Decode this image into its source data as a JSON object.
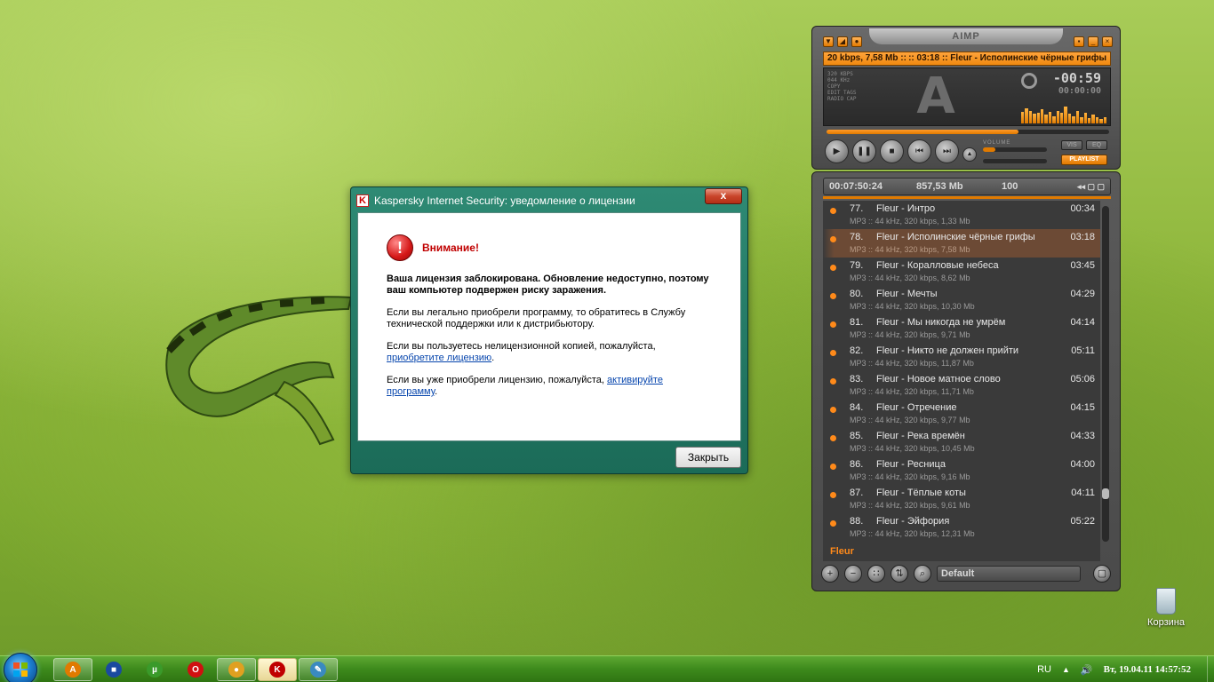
{
  "kaspersky": {
    "title": "Kaspersky Internet Security: уведомление о лицензии",
    "logo_letter": "K",
    "close_glyph": "x",
    "warning_glyph": "!",
    "heading": "Внимание!",
    "p1": "Ваша лицензия заблокирована. Обновление недоступно, поэтому ваш компьютер подвержен риску заражения.",
    "p2": "Если вы легально приобрели программу, то обратитесь в Службу технической поддержки или к дистрибьютору.",
    "p3_text": "Если вы пользуетесь нелицензионной копией, пожалуйста,",
    "p3_link": "приобретите лицензию",
    "p3_end": ".",
    "p4_text": "Если вы уже приобрели лицензию, пожалуйста,",
    "p4_link": "активируйте программу",
    "p4_end": ".",
    "close_button": "Закрыть",
    "accent": "#1b6b58"
  },
  "aimp": {
    "app_name": "AIMP",
    "ticker_left": "20 kbps, 7,58 Mb ::",
    "ticker_right": ":: 03:18 :: Fleur - Исполинские чёрные грифы",
    "info_lines": [
      "320 KBPS",
      "044 KHz",
      "COPY",
      "EDIT TAGS",
      "RADIO CAP"
    ],
    "logo_letter": "A",
    "time_remaining": "-00:59",
    "time_elapsed": "00:00:00",
    "seek_progress": 0.68,
    "volume_label": "VOLUME",
    "volume_level": 0.2,
    "btn_vis": "VIS",
    "btn_eq": "EQ",
    "btn_playlist": "PLAYLIST",
    "controls": [
      "play-icon",
      "pause-icon",
      "stop-icon",
      "prev-icon",
      "next-icon",
      "eject-icon"
    ],
    "accent": "#e07a00",
    "vis_bars": [
      0.55,
      0.7,
      0.6,
      0.45,
      0.5,
      0.65,
      0.4,
      0.55,
      0.35,
      0.6,
      0.5,
      0.8,
      0.45,
      0.35,
      0.6,
      0.3,
      0.5,
      0.25,
      0.4,
      0.3,
      0.2,
      0.3
    ]
  },
  "playlist": {
    "total_time": "00:07:50:24",
    "total_size": "857,53 Mb",
    "count": "100",
    "group": "Fleur",
    "name": "Default",
    "items": [
      {
        "num": "77.",
        "title": "Fleur - Интро",
        "dur": "00:34",
        "info": "MP3 :: 44 kHz, 320 kbps, 1,33 Mb",
        "active": false
      },
      {
        "num": "78.",
        "title": "Fleur - Исполинские чёрные грифы",
        "dur": "03:18",
        "info": "MP3 :: 44 kHz, 320 kbps, 7,58 Mb",
        "active": true
      },
      {
        "num": "79.",
        "title": "Fleur - Коралловые небеса",
        "dur": "03:45",
        "info": "MP3 :: 44 kHz, 320 kbps, 8,62 Mb",
        "active": false
      },
      {
        "num": "80.",
        "title": "Fleur - Мечты",
        "dur": "04:29",
        "info": "MP3 :: 44 kHz, 320 kbps, 10,30 Mb",
        "active": false
      },
      {
        "num": "81.",
        "title": "Fleur - Мы никогда не умрём",
        "dur": "04:14",
        "info": "MP3 :: 44 kHz, 320 kbps, 9,71 Mb",
        "active": false
      },
      {
        "num": "82.",
        "title": "Fleur - Никто не должен прийти",
        "dur": "05:11",
        "info": "MP3 :: 44 kHz, 320 kbps, 11,87 Mb",
        "active": false
      },
      {
        "num": "83.",
        "title": "Fleur - Новое матное слово",
        "dur": "05:06",
        "info": "MP3 :: 44 kHz, 320 kbps, 11,71 Mb",
        "active": false
      },
      {
        "num": "84.",
        "title": "Fleur - Отречение",
        "dur": "04:15",
        "info": "MP3 :: 44 kHz, 320 kbps, 9,77 Mb",
        "active": false
      },
      {
        "num": "85.",
        "title": "Fleur - Река времён",
        "dur": "04:33",
        "info": "MP3 :: 44 kHz, 320 kbps, 10,45 Mb",
        "active": false
      },
      {
        "num": "86.",
        "title": "Fleur - Ресница",
        "dur": "04:00",
        "info": "MP3 :: 44 kHz, 320 kbps, 9,16 Mb",
        "active": false
      },
      {
        "num": "87.",
        "title": "Fleur - Тёплые коты",
        "dur": "04:11",
        "info": "MP3 :: 44 kHz, 320 kbps, 9,61 Mb",
        "active": false
      },
      {
        "num": "88.",
        "title": "Fleur - Эйфория",
        "dur": "05:22",
        "info": "MP3 :: 44 kHz, 320 kbps, 12,31 Mb",
        "active": false
      }
    ],
    "bottom_buttons": [
      "add-icon",
      "remove-icon",
      "options-icon",
      "sort-icon",
      "search-icon"
    ]
  },
  "desktop": {
    "recycle_label": "Корзина"
  },
  "taskbar": {
    "buttons": [
      {
        "name": "aimp-taskbar-button",
        "icon": "aimp-icon",
        "glyph": "A",
        "color": "#e07a00",
        "state": "pinned"
      },
      {
        "name": "floppy-taskbar-button",
        "icon": "floppy-icon",
        "glyph": "■",
        "color": "#1a4aa0",
        "state": "plain"
      },
      {
        "name": "utorrent-taskbar-button",
        "icon": "utorrent-icon",
        "glyph": "µ",
        "color": "#3a9a2a",
        "state": "plain"
      },
      {
        "name": "opera-taskbar-button",
        "icon": "opera-icon",
        "glyph": "O",
        "color": "#d01010",
        "state": "plain"
      },
      {
        "name": "chrome-taskbar-button",
        "icon": "chrome-icon",
        "glyph": "●",
        "color": "#e0a020",
        "state": "pinned"
      },
      {
        "name": "kaspersky-taskbar-button",
        "icon": "kaspersky-icon",
        "glyph": "K",
        "color": "#c00000",
        "state": "active"
      },
      {
        "name": "paint-taskbar-button",
        "icon": "paint-icon",
        "glyph": "✎",
        "color": "#3a8ac0",
        "state": "pinned"
      }
    ],
    "lang": "RU",
    "clock": "Вт, 19.04.11 14:57:52",
    "flag_glyph": "▲",
    "speaker_glyph": "🔊"
  }
}
